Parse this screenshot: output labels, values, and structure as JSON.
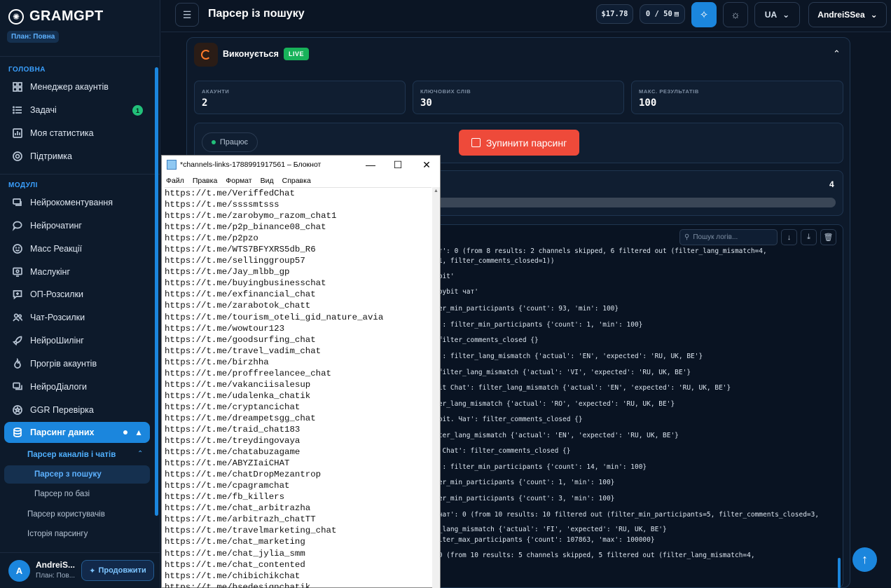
{
  "brand": {
    "name": "GRAMGPT",
    "plan_badge": "План: Повна"
  },
  "sidebar": {
    "section_main": "ГОЛОВНА",
    "main_items": [
      {
        "label": "Менеджер акаунтів",
        "icon": "grid-icon"
      },
      {
        "label": "Задачі",
        "icon": "list-icon",
        "badge": "1"
      },
      {
        "label": "Моя статистика",
        "icon": "chart-icon"
      },
      {
        "label": "Підтримка",
        "icon": "lifebuoy-icon"
      }
    ],
    "section_modules": "МОДУЛІ",
    "module_items": [
      {
        "label": "Нейрокоментування",
        "icon": "comments-icon"
      },
      {
        "label": "Нейрочатинг",
        "icon": "chat-bubble-icon"
      },
      {
        "label": "Масс Реакції",
        "icon": "smile-icon"
      },
      {
        "label": "Маслукінг",
        "icon": "monitor-eye-icon"
      },
      {
        "label": "ОП-Розсилки",
        "icon": "message-plus-icon"
      },
      {
        "label": "Чат-Розсилки",
        "icon": "users-icon"
      },
      {
        "label": "НейроШилінг",
        "icon": "rocket-icon"
      },
      {
        "label": "Прогрів акаунтів",
        "icon": "flame-icon"
      },
      {
        "label": "НейроДіалоги",
        "icon": "dialog-icon"
      },
      {
        "label": "GGR Перевірка",
        "icon": "star-badge-icon"
      },
      {
        "label": "Парсинг даних",
        "icon": "database-icon"
      }
    ],
    "sub_group": "Парсер каналів і чатів",
    "sub_items": [
      "Парсер з пошуку",
      "Парсер по базі"
    ],
    "other_items": [
      "Парсер користувачів",
      "Історія парсингу"
    ],
    "user": {
      "initial": "A",
      "name": "AndreiS...",
      "plan": "План: Пов...",
      "continue_label": "Продовжити"
    }
  },
  "header": {
    "title": "Парсер із пошуку",
    "balance": "$17.78",
    "quota": "0 / 50",
    "lang": "UA",
    "username": "AndreiSSea"
  },
  "status": {
    "label": "Виконується",
    "live": "LIVE",
    "stats": [
      {
        "label": "АКАУНТИ",
        "value": "2"
      },
      {
        "label": "КЛЮЧОВИХ СЛІВ",
        "value": "30"
      },
      {
        "label": "МАКС. РЕЗУЛЬТАТІВ",
        "value": "100"
      }
    ],
    "working": "Працює",
    "stop_label": "Зупинити парсинг",
    "progress_count": "4"
  },
  "logs": {
    "search_placeholder": "Пошук логів...",
    "lines": [
      "ат': 0 (from 8 results: 2 channels skipped, 6 filtered out (filter_lang_mismatch=4,",
      "=1, filter_comments_closed=1))",
      "ybit'",
      "'bybit чат'",
      "ler_min_participants {'count': 93, 'min': 100}",
      "t': filter_min_participants {'count': 1, 'min': 100}",
      " filter_comments_closed {}",
      "t': filter_lang_mismatch {'actual': 'EN', 'expected': 'RU, UK, BE'}",
      " filter_lang_mismatch {'actual': 'VI', 'expected': 'RU, UK, BE'}",
      "bit Chat': filter_lang_mismatch {'actual': 'EN', 'expected': 'RU, UK, BE'}",
      "ter_lang_mismatch {'actual': 'RO', 'expected': 'RU, UK, BE'}",
      "ybit. Чат': filter_comments_closed {}",
      "lter_lang_mismatch {'actual': 'EN', 'expected': 'RU, UK, BE'}",
      "| Chat': filter_comments_closed {}",
      "t': filter_min_participants {'count': 14, 'min': 100}",
      "ter_min_participants {'count': 1, 'min': 100}",
      "ter_min_participants {'count': 3, 'min': 100}",
      " чат': 0 (from 10 results: 10 filtered out (filter_min_participants=5, filter_comments_closed=3,",
      "r_lang_mismatch {'actual': 'FI', 'expected': 'RU, UK, BE'}",
      "ilter_max_participants {'count': 107863, 'max': 100000}",
      " 0 (from 10 results: 5 channels skipped, 5 filtered out (filter_lang_mismatch=4,",
      ")"
    ]
  },
  "notepad": {
    "title": "*channels-links-1788991917561 – Блокнот",
    "menu": [
      "Файл",
      "Правка",
      "Формат",
      "Вид",
      "Справка"
    ],
    "lines": [
      "https://t.me/VeriffedChat",
      "https://t.me/ssssmtsss",
      "https://t.me/zarobymo_razom_chat1",
      "https://t.me/p2p_binance08_chat",
      "https://t.me/p2pzo",
      "https://t.me/WTS7BFYXRS5db_R6",
      "https://t.me/sellinggroup57",
      "https://t.me/Jay_mlbb_gp",
      "https://t.me/buyingbusinesschat",
      "https://t.me/exfinancial_chat",
      "https://t.me/zarabotok_chatt",
      "https://t.me/tourism_oteli_gid_nature_avia",
      "https://t.me/wowtour123",
      "https://t.me/goodsurfing_chat",
      "https://t.me/travel_vadim_chat",
      "https://t.me/birzhha",
      "https://t.me/proffreelancee_chat",
      "https://t.me/vakanciisalesup",
      "https://t.me/udalenka_chatik",
      "https://t.me/cryptancichat",
      "https://t.me/dreampetsgg_chat",
      "https://t.me/traid_chat183",
      "https://t.me/treydingovaya",
      "https://t.me/chatabuzagame",
      "https://t.me/ABYZIaiCHAT",
      "https://t.me/chatDropMezantrop",
      "https://t.me/cpagramchat",
      "https://t.me/fb_killers",
      "https://t.me/chat_arbitrazha",
      "https://t.me/arbitrazh_chatTT",
      "https://t.me/travelmarketing_chat",
      "https://t.me/chat_marketing",
      "https://t.me/chat_jylia_smm",
      "https://t.me/chat_contented",
      "https://t.me/chibichikchat",
      "https://t.me/hsedesignchatik"
    ]
  },
  "colors": {
    "accent": "#1b86dd",
    "danger": "#ee4a3a",
    "live": "#18b25a",
    "bg": "#0b1524"
  }
}
